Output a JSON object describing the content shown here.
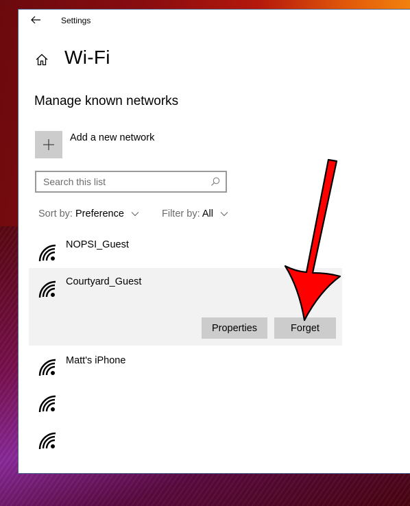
{
  "window": {
    "app_title": "Settings",
    "back_icon": "arrow-left-icon",
    "home_icon": "home-icon"
  },
  "page": {
    "title": "Wi-Fi",
    "section_title": "Manage known networks"
  },
  "add_network": {
    "icon": "plus-icon",
    "label": "Add a new network"
  },
  "search": {
    "placeholder": "Search this list",
    "value": "",
    "icon": "search-icon"
  },
  "sort": {
    "label": "Sort by:",
    "value": "Preference"
  },
  "filter": {
    "label": "Filter by:",
    "value": "All"
  },
  "networks": [
    {
      "name": "NOPSI_Guest",
      "icon": "wifi-icon",
      "selected": false
    },
    {
      "name": "Courtyard_Guest",
      "icon": "wifi-icon",
      "selected": true
    },
    {
      "name": "Matt's iPhone",
      "icon": "wifi-icon",
      "selected": false
    },
    {
      "name": "",
      "icon": "wifi-icon",
      "selected": false
    },
    {
      "name": "",
      "icon": "wifi-icon",
      "selected": false
    }
  ],
  "selected_actions": {
    "properties_label": "Properties",
    "forget_label": "Forget"
  },
  "annotation": {
    "type": "red-arrow",
    "points_to": "Forget",
    "color": "#ff0000"
  },
  "colors": {
    "selected_row_bg": "#f2f2f2",
    "button_bg": "#cccccc",
    "arrow_fill": "#ff0000"
  }
}
